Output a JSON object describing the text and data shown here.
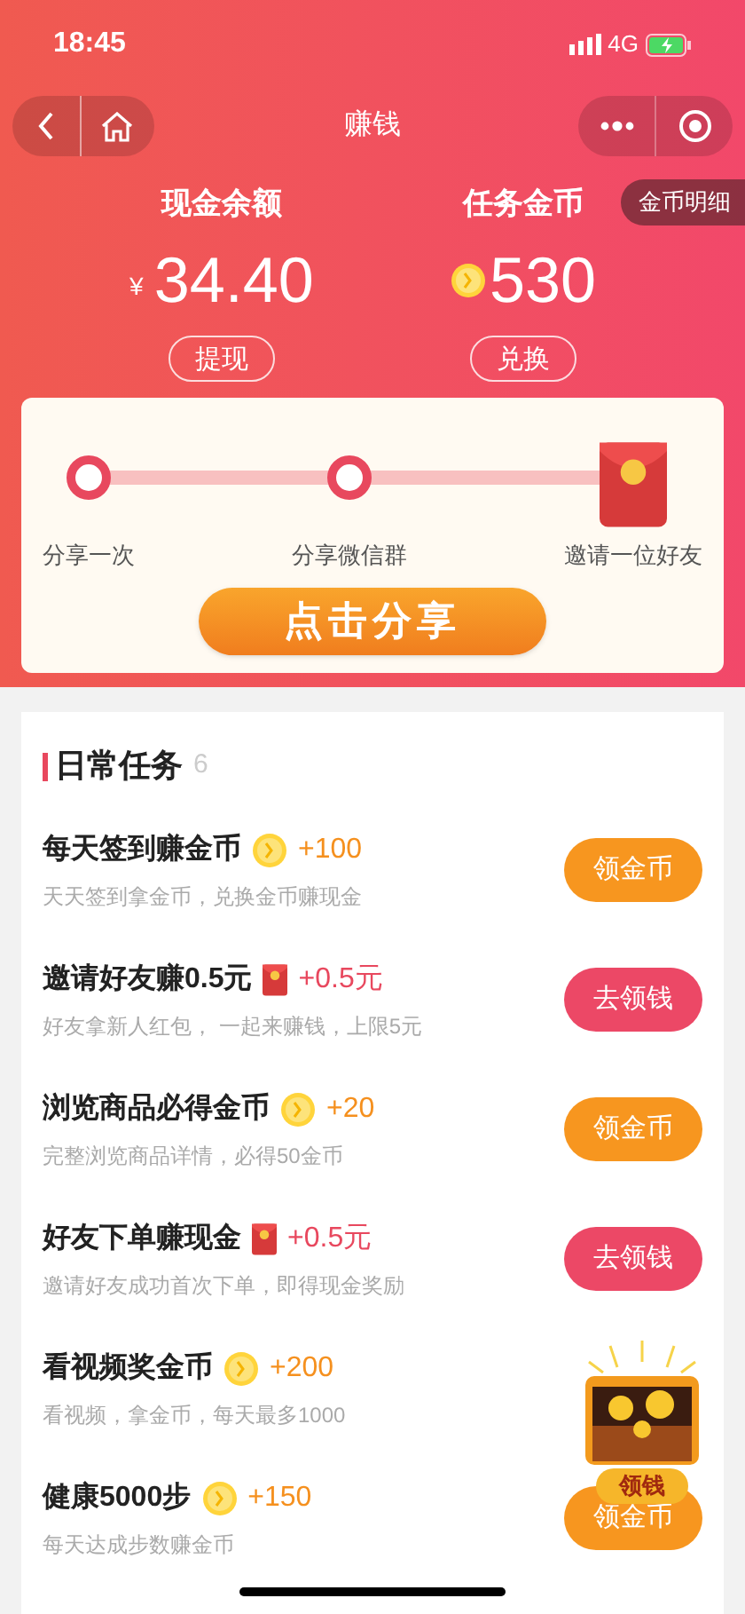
{
  "status_bar": {
    "time": "18:45",
    "network": "4G"
  },
  "nav": {
    "title": "赚钱"
  },
  "balances": [
    {
      "label": "现金余额",
      "currency": "¥",
      "amount": "34.40",
      "button": "提现",
      "kind": "cash"
    },
    {
      "label": "任务金币",
      "amount": "530",
      "button": "兑换",
      "kind": "coin",
      "detail_tab": "金币明细"
    }
  ],
  "share_steps": [
    {
      "label": "分享一次",
      "kind": "circle"
    },
    {
      "label": "分享微信群",
      "kind": "circle"
    },
    {
      "label": "邀请一位好友",
      "kind": "envelope"
    }
  ],
  "share_button": "点击分享",
  "daily_tasks": {
    "title": "日常任务",
    "count": "6",
    "items": [
      {
        "title": "每天签到赚金币",
        "reward": "+100",
        "kind": "coin",
        "description": "天天签到拿金币，兑换金币赚现金",
        "button": "领金币"
      },
      {
        "title": "邀请好友赚0.5元",
        "reward": "+0.5元",
        "kind": "cash",
        "description": "好友拿新人红包， 一起来赚钱，上限5元",
        "button": "去领钱"
      },
      {
        "title": "浏览商品必得金币",
        "reward": "+20",
        "kind": "coin",
        "description": "完整浏览商品详情，必得50金币",
        "button": "领金币"
      },
      {
        "title": "好友下单赚现金",
        "reward": "+0.5元",
        "kind": "cash",
        "description": "邀请好友成功首次下单，即得现金奖励",
        "button": "去领钱"
      },
      {
        "title": "看视频奖金币",
        "reward": "+200",
        "kind": "coin",
        "description": "看视频，拿金币，每天最多1000"
      },
      {
        "title": "健康5000步",
        "reward": "+150",
        "kind": "coin",
        "description": "每天达成步数赚金币",
        "button": "领金币"
      }
    ]
  },
  "floating_chest": {
    "label": "领钱"
  }
}
